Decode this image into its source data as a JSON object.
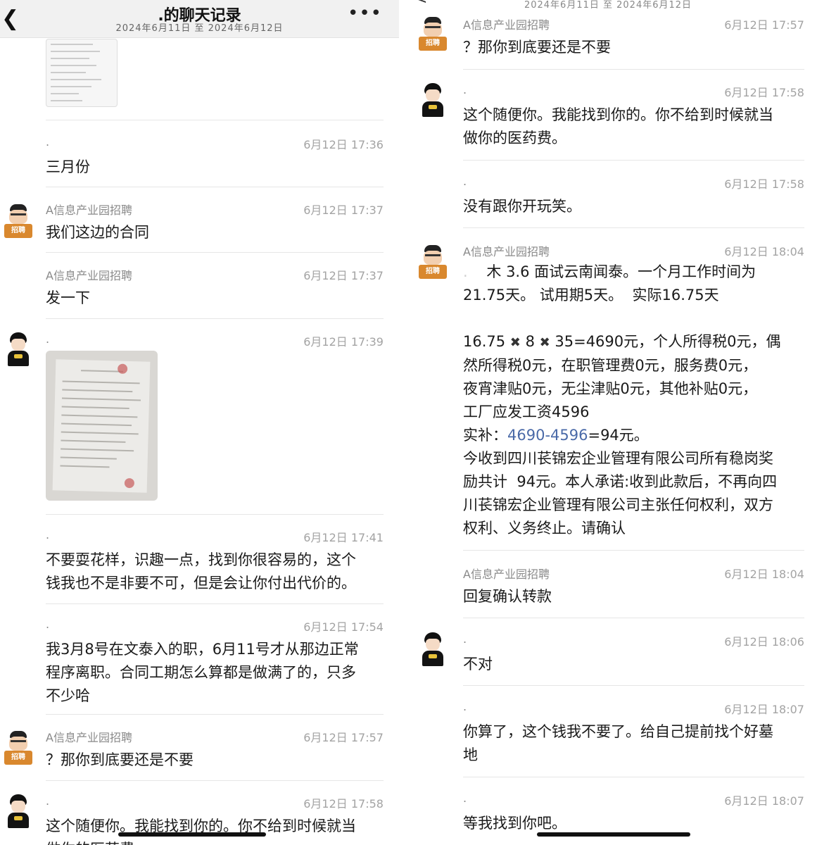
{
  "header": {
    "title": ".的聊天记录",
    "date_range": "2024年6月11日 至 2024年6月12日",
    "more": "•••",
    "back": "<"
  },
  "left_messages": [
    {
      "name": ".",
      "time": "6月12日 17:36",
      "text": "三月份"
    },
    {
      "name": "A信息产业园招聘",
      "time": "6月12日 17:37",
      "text": "我们这边的合同"
    },
    {
      "name": "A信息产业园招聘",
      "time": "6月12日 17:37",
      "text": "发一下"
    },
    {
      "name": ".",
      "time": "6月12日 17:39",
      "text": ""
    },
    {
      "name": ".",
      "time": "6月12日 17:41",
      "text": "不要耍花样，识趣一点，找到你很容易的，这个\n钱我也不是非要不可，但是会让你付出代价的。"
    },
    {
      "name": ".",
      "time": "6月12日 17:54",
      "text": "我3月8号在文泰入的职，6月11号才从那边正常\n程序离职。合同工期怎么算都是做满了的，只多\n不少哈"
    },
    {
      "name": "A信息产业园招聘",
      "time": "6月12日 17:57",
      "text": "？那你到底要还是不要"
    },
    {
      "name": ".",
      "time": "6月12日 17:58",
      "text": "这个随便你。我能找到你的。你不给到时候就当\n做你的医药费"
    }
  ],
  "right_messages": [
    {
      "name": "A信息产业园招聘",
      "time": "6月12日 17:57",
      "text": "？那你到底要还是不要"
    },
    {
      "name": ".",
      "time": "6月12日 17:58",
      "text": "这个随便你。我能找到你的。你不给到时候就当\n做你的医药费。"
    },
    {
      "name": ".",
      "time": "6月12日 17:58",
      "text": "没有跟你开玩笑。"
    },
    {
      "name": "A信息产业园招聘",
      "time": "6月12日 18:04",
      "line1_blur": ".    ",
      "line1": "木 3.6 面试云南闻泰。一个月工作时间为",
      "line2": "21.75天。 试用期5天。  实际16.75天",
      "formula_a": "16.75 ",
      "cross": "✖",
      "formula_b": " 8 ",
      "formula_c": " 35=4690元，个人所得税0元，偶",
      "line4": "然所得税0元，在职管理费0元，服务费0元，",
      "line5": "夜宵津贴0元，无尘津贴0元，其他补贴0元，",
      "line6": "工厂应发工资4596",
      "line7_a": "实补：",
      "line7_link": "4690-4596",
      "line7_b": "=94元。",
      "line8": "今收到四川苌锦宏企业管理有限公司所有稳岗奖\n励共计  94元。本人承诺:收到此款后，不再向四\n川苌锦宏企业管理有限公司主张任何权利，双方\n权利、义务终止。请确认"
    },
    {
      "name": "A信息产业园招聘",
      "time": "6月12日 18:04",
      "text": "回复确认转款"
    },
    {
      "name": ".",
      "time": "6月12日 18:06",
      "text": "不对"
    },
    {
      "name": ".",
      "time": "6月12日 18:07",
      "text": "你算了，这个钱我不要了。给自己提前找个好墓\n地"
    },
    {
      "name": ".",
      "time": "6月12日 18:07",
      "text": "等我找到你吧。"
    }
  ],
  "avatars": {
    "recruiter_sign": "招聘"
  }
}
